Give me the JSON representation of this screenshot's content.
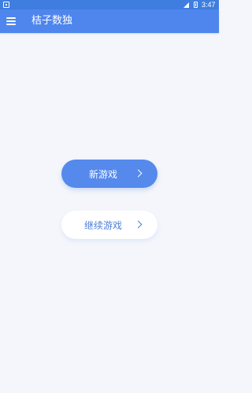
{
  "status_bar": {
    "time": "3:47",
    "icons": [
      "notification-icon",
      "signal-icon",
      "battery-icon"
    ]
  },
  "app_bar": {
    "title": "桔子数独",
    "menu_icon": "menu-icon",
    "background_color": "#4e86ee"
  },
  "main": {
    "new_game_label": "新游戏",
    "continue_game_label": "继续游戏",
    "chevron_icon": "chevron-right-icon",
    "primary_button_color": "#5589eb",
    "secondary_button_text_color": "#4f7fd8"
  }
}
